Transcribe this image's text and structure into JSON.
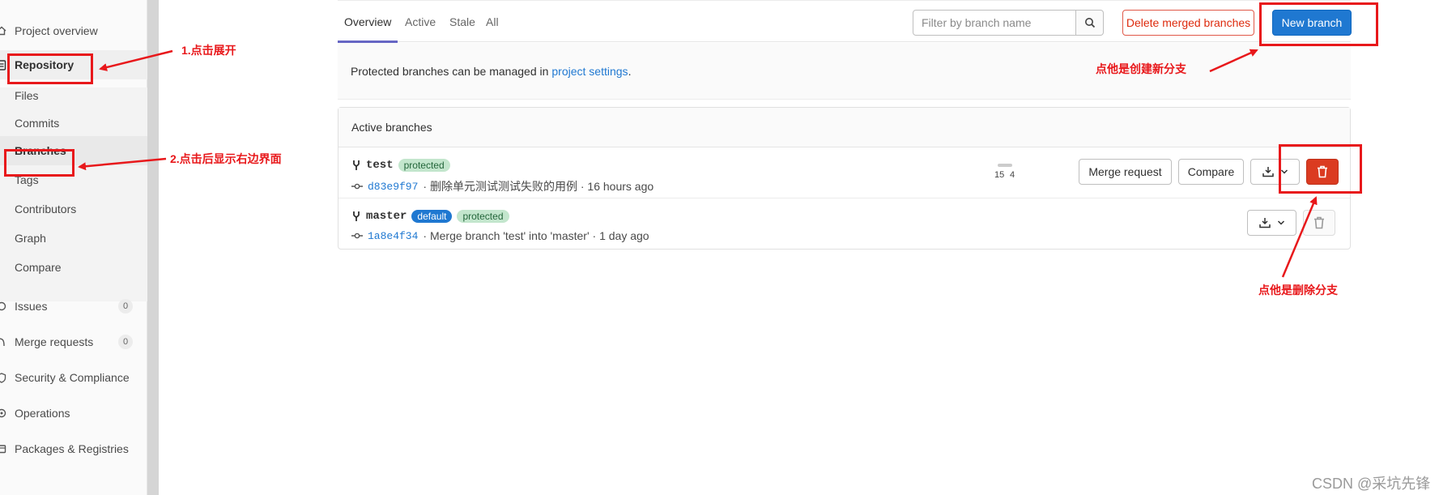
{
  "sidebar": {
    "items": [
      {
        "label": "Project overview",
        "icon": "home-icon"
      },
      {
        "label": "Repository",
        "icon": "document-icon"
      },
      {
        "label": "Files"
      },
      {
        "label": "Commits"
      },
      {
        "label": "Branches"
      },
      {
        "label": "Tags"
      },
      {
        "label": "Contributors"
      },
      {
        "label": "Graph"
      },
      {
        "label": "Compare"
      },
      {
        "label": "Issues",
        "icon": "issues-icon",
        "count": "0"
      },
      {
        "label": "Merge requests",
        "icon": "merge-request-icon",
        "count": "0"
      },
      {
        "label": "Security & Compliance",
        "icon": "shield-icon"
      },
      {
        "label": "Operations",
        "icon": "cloud-icon"
      },
      {
        "label": "Packages & Registries",
        "icon": "package-icon"
      }
    ]
  },
  "annotations": {
    "step1": "1.点击展开",
    "step2": "2.点击后显示右边界面",
    "new_branch_note": "点他是创建新分支",
    "delete_note": "点他是删除分支"
  },
  "tabs": [
    {
      "label": "Overview",
      "active": true
    },
    {
      "label": "Active"
    },
    {
      "label": "Stale"
    },
    {
      "label": "All"
    }
  ],
  "filter": {
    "placeholder": "Filter by branch name"
  },
  "buttons": {
    "delete_merged": "Delete merged branches",
    "new_branch": "New branch",
    "merge_request": "Merge request",
    "compare": "Compare"
  },
  "info": {
    "text": "Protected branches can be managed in",
    "link": "project settings",
    "suffix": "."
  },
  "active_branches": {
    "title": "Active branches",
    "rows": [
      {
        "name": "test",
        "badges": [
          "protected"
        ],
        "sha": "d83e9f97",
        "message": "· 删除单元测试测试失败的用例 · 16 hours ago",
        "behind": "15",
        "ahead": "4"
      },
      {
        "name": "master",
        "badges": [
          "default",
          "protected"
        ],
        "sha": "1a8e4f34",
        "message": "· Merge branch 'test' into 'master' · 1 day ago"
      }
    ]
  },
  "watermark": "CSDN @采坑先锋",
  "colors": {
    "annotation_red": "#e8181b",
    "primary_blue": "#1f78d1",
    "danger_red": "#db3b21",
    "protected_green": "#c3e6cd"
  }
}
